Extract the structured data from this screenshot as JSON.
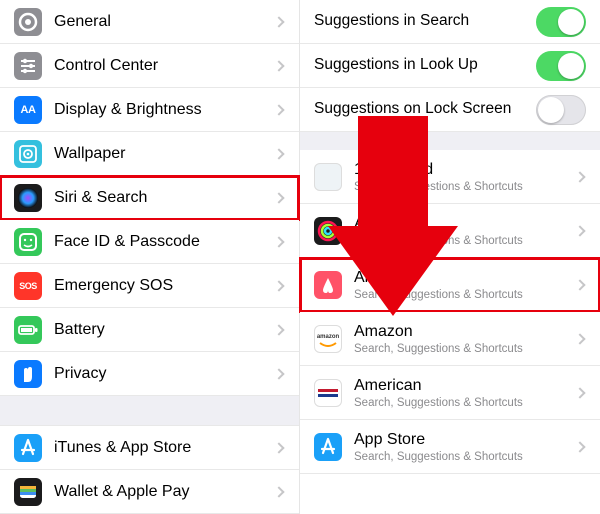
{
  "left": {
    "items": [
      {
        "label": "General",
        "icon": "gear",
        "bg": "#8e8e93"
      },
      {
        "label": "Control Center",
        "icon": "sliders",
        "bg": "#8e8e93"
      },
      {
        "label": "Display & Brightness",
        "icon": "AA",
        "bg": "#0a7aff",
        "textIcon": true
      },
      {
        "label": "Wallpaper",
        "icon": "wallpaper",
        "bg": "#34c0de"
      },
      {
        "label": "Siri & Search",
        "icon": "siri",
        "bg": "#1b1b1c",
        "highlight": true
      },
      {
        "label": "Face ID & Passcode",
        "icon": "face",
        "bg": "#34c85a"
      },
      {
        "label": "Emergency SOS",
        "icon": "SOS",
        "bg": "#ff3529",
        "textIcon": true
      },
      {
        "label": "Battery",
        "icon": "battery",
        "bg": "#34c85a"
      },
      {
        "label": "Privacy",
        "icon": "hand",
        "bg": "#0a7aff"
      }
    ],
    "group2": [
      {
        "label": "iTunes & App Store",
        "icon": "appstore",
        "bg": "#1aa0f8"
      },
      {
        "label": "Wallet & Apple Pay",
        "icon": "wallet",
        "bg": "#1b1b1c"
      }
    ]
  },
  "right": {
    "toggles": [
      {
        "label": "Suggestions in Search",
        "on": true
      },
      {
        "label": "Suggestions in Look Up",
        "on": true
      },
      {
        "label": "Suggestions on Lock Screen",
        "on": false
      }
    ],
    "apps": [
      {
        "name": "1Password",
        "sub": "Search, Suggestions & Shortcuts",
        "bg": "#eef3f6",
        "masked": true
      },
      {
        "name": "Activity",
        "sub": "Search, Suggestions & Shortcuts",
        "bg": "#1b1b1c",
        "masked": true
      },
      {
        "name": "Airbnb",
        "sub": "Search, Suggestions & Shortcuts",
        "bg": "#ff5268",
        "highlight": true
      },
      {
        "name": "Amazon",
        "sub": "Search, Suggestions & Shortcuts",
        "bg": "#ffffff"
      },
      {
        "name": "American",
        "sub": "Search, Suggestions & Shortcuts",
        "bg": "#ffffff"
      },
      {
        "name": "App Store",
        "sub": "Search, Suggestions & Shortcuts",
        "bg": "#1aa0f8"
      }
    ]
  }
}
